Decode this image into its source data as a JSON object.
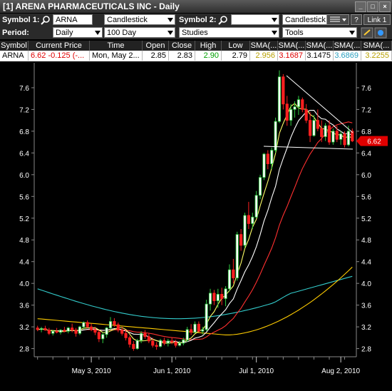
{
  "window": {
    "title": "[1] ARENA PHARMACEUTICALS INC - Daily",
    "buttons": [
      "_",
      "□",
      "×"
    ]
  },
  "toolbar1": {
    "symbol1_label": "Symbol 1:",
    "symbol1_value": "ARNA",
    "chart_type": "Candlestick",
    "symbol2_label": "Symbol 2:",
    "symbol2_value": "",
    "chart_type2": "Candlestick",
    "help_label": "?",
    "link_label": "Link 1"
  },
  "toolbar2": {
    "period_label": "Period:",
    "period_value": "Daily",
    "range_value": "100 Day",
    "studies_value": "Studies",
    "tools_value": "Tools"
  },
  "quote": {
    "headers": [
      "Symbol",
      "Current Price",
      "Time",
      "Open",
      "Close",
      "High",
      "Low",
      "SMA(...",
      "SMA(...",
      "SMA(...",
      "SMA(...",
      "SMA(..."
    ],
    "values": [
      "ARNA",
      "6.62  -0.125 (-...",
      "Mon, May 2...",
      "2.85",
      "2.83",
      "2.90",
      "2.79",
      "2.956",
      "3.1687",
      "3.1475",
      "3.6869",
      "3.2255"
    ]
  },
  "colors": {
    "up": "#2ecc40",
    "down": "#ff2020",
    "sma5": "#ffff66",
    "sma10": "#ffffff",
    "sma20": "#ff3030",
    "sma50": "#ffcc00",
    "sma200": "#33cccc",
    "price_tag": "#e00000"
  },
  "chart_data": {
    "type": "candlestick",
    "x_tick_labels": [
      "May 3, 2010",
      "Jun 1, 2010",
      "Jul 1, 2010",
      "Aug 2, 2010"
    ],
    "y_ticks": [
      2.8,
      3.2,
      3.6,
      4.0,
      4.4,
      4.8,
      5.2,
      5.6,
      6.0,
      6.4,
      6.8,
      7.2,
      7.6
    ],
    "ylim": [
      2.65,
      7.98
    ],
    "current_price_label": "6.62",
    "candles": [
      [
        3.18,
        3.22,
        3.12,
        3.15
      ],
      [
        3.15,
        3.2,
        3.1,
        3.17
      ],
      [
        3.17,
        3.22,
        3.13,
        3.14
      ],
      [
        3.14,
        3.18,
        3.05,
        3.08
      ],
      [
        3.08,
        3.14,
        3.04,
        3.12
      ],
      [
        3.12,
        3.18,
        3.08,
        3.1
      ],
      [
        3.1,
        3.16,
        3.06,
        3.14
      ],
      [
        3.14,
        3.2,
        3.1,
        3.12
      ],
      [
        3.12,
        3.2,
        3.08,
        3.18
      ],
      [
        3.18,
        3.26,
        3.1,
        3.14
      ],
      [
        3.14,
        3.18,
        3.02,
        3.08
      ],
      [
        3.08,
        3.22,
        3.05,
        3.2
      ],
      [
        3.2,
        3.3,
        3.15,
        3.28
      ],
      [
        3.28,
        3.32,
        3.18,
        3.2
      ],
      [
        3.2,
        3.26,
        3.12,
        3.15
      ],
      [
        3.15,
        3.2,
        3.05,
        3.1
      ],
      [
        3.1,
        3.14,
        2.92,
        2.98
      ],
      [
        2.98,
        3.1,
        2.9,
        3.06
      ],
      [
        3.06,
        3.2,
        3.0,
        3.18
      ],
      [
        3.18,
        3.38,
        3.14,
        3.3
      ],
      [
        3.3,
        3.36,
        3.2,
        3.24
      ],
      [
        3.24,
        3.28,
        3.1,
        3.14
      ],
      [
        3.14,
        3.2,
        3.04,
        3.08
      ],
      [
        3.08,
        3.14,
        2.95,
        3.0
      ],
      [
        3.0,
        3.04,
        2.82,
        2.88
      ],
      [
        2.88,
        2.94,
        2.76,
        2.8
      ],
      [
        2.8,
        2.98,
        2.78,
        2.95
      ],
      [
        2.95,
        3.12,
        2.9,
        3.08
      ],
      [
        3.08,
        3.14,
        2.98,
        3.02
      ],
      [
        3.02,
        3.08,
        2.9,
        2.94
      ],
      [
        2.94,
        3.0,
        2.82,
        2.86
      ],
      [
        2.86,
        2.92,
        2.78,
        2.84
      ],
      [
        2.84,
        2.98,
        2.82,
        2.95
      ],
      [
        2.95,
        3.0,
        2.86,
        2.9
      ],
      [
        2.9,
        2.98,
        2.84,
        2.94
      ],
      [
        2.94,
        3.0,
        2.88,
        2.92
      ],
      [
        2.92,
        2.96,
        2.82,
        2.86
      ],
      [
        2.86,
        2.94,
        2.84,
        2.9
      ],
      [
        2.9,
        3.0,
        2.86,
        2.96
      ],
      [
        2.96,
        3.2,
        2.92,
        3.15
      ],
      [
        3.15,
        3.25,
        3.05,
        3.1
      ],
      [
        3.1,
        3.3,
        3.08,
        3.25
      ],
      [
        3.25,
        3.3,
        3.1,
        3.12
      ],
      [
        3.12,
        3.2,
        3.06,
        3.15
      ],
      [
        3.15,
        3.7,
        3.12,
        3.62
      ],
      [
        3.62,
        3.9,
        3.5,
        3.82
      ],
      [
        3.82,
        3.88,
        3.6,
        3.68
      ],
      [
        3.68,
        3.9,
        3.55,
        3.8
      ],
      [
        3.8,
        3.92,
        3.6,
        3.72
      ],
      [
        3.72,
        3.95,
        3.58,
        3.9
      ],
      [
        3.9,
        4.35,
        3.85,
        4.25
      ],
      [
        4.25,
        4.45,
        4.0,
        4.1
      ],
      [
        4.1,
        4.95,
        4.05,
        4.9
      ],
      [
        4.9,
        5.0,
        4.6,
        4.7
      ],
      [
        4.7,
        5.3,
        4.65,
        5.25
      ],
      [
        5.25,
        5.5,
        5.0,
        5.1
      ],
      [
        5.1,
        5.3,
        5.0,
        5.22
      ],
      [
        5.22,
        5.7,
        5.2,
        5.62
      ],
      [
        5.62,
        6.0,
        5.55,
        5.95
      ],
      [
        5.95,
        6.4,
        5.9,
        6.38
      ],
      [
        6.38,
        6.45,
        6.1,
        6.2
      ],
      [
        6.2,
        6.5,
        6.1,
        6.45
      ],
      [
        6.45,
        7.05,
        6.4,
        6.98
      ],
      [
        6.98,
        7.92,
        6.95,
        7.8
      ],
      [
        7.8,
        7.85,
        7.2,
        7.3
      ],
      [
        7.3,
        7.45,
        6.9,
        7.0
      ],
      [
        7.0,
        7.3,
        6.9,
        7.2
      ],
      [
        7.2,
        7.35,
        7.05,
        7.25
      ],
      [
        7.25,
        7.45,
        7.1,
        7.38
      ],
      [
        7.38,
        7.42,
        7.15,
        7.2
      ],
      [
        7.2,
        7.3,
        6.95,
        7.0
      ],
      [
        7.0,
        7.15,
        6.6,
        6.72
      ],
      [
        6.72,
        7.1,
        6.7,
        7.0
      ],
      [
        7.0,
        7.2,
        6.8,
        6.85
      ],
      [
        6.85,
        7.0,
        6.6,
        6.7
      ],
      [
        6.7,
        6.95,
        6.62,
        6.9
      ],
      [
        6.9,
        7.0,
        6.55,
        6.6
      ],
      [
        6.6,
        6.85,
        6.55,
        6.8
      ],
      [
        6.8,
        6.9,
        6.6,
        6.65
      ],
      [
        6.65,
        6.8,
        6.55,
        6.75
      ],
      [
        6.75,
        6.8,
        6.5,
        6.55
      ],
      [
        6.55,
        6.9,
        6.52,
        6.8
      ],
      [
        6.8,
        6.85,
        6.6,
        6.62
      ]
    ]
  }
}
